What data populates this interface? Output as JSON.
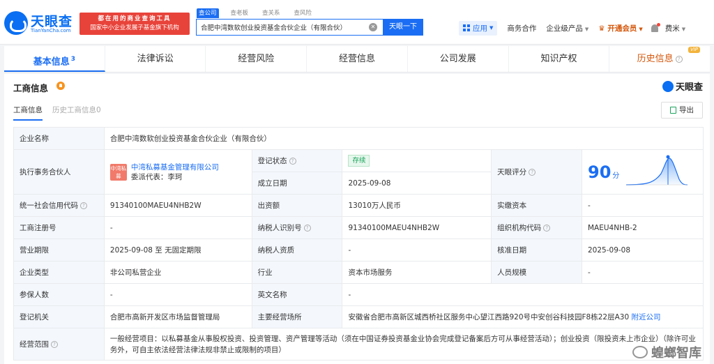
{
  "header": {
    "logo_text": "天眼查",
    "logo_sub": "TianYanCha.com",
    "banner_line1": "都在用的商业查询工具",
    "banner_line2": "国家中小企业发展子基金旗下机构",
    "search_tabs": [
      "查公司",
      "查老板",
      "查关系",
      "查风险"
    ],
    "search_value": "合肥中湾数软创业投资基金合伙企业（有限合伙）",
    "search_button": "天眼一下",
    "app_label": "应用",
    "nav_items": [
      "商务合作",
      "企业级产品"
    ],
    "vip_label": "开通会员",
    "user_label": "费米"
  },
  "tabs": [
    {
      "label": "基本信息",
      "count": "3"
    },
    {
      "label": "法律诉讼"
    },
    {
      "label": "经营风险"
    },
    {
      "label": "经营信息"
    },
    {
      "label": "公司发展"
    },
    {
      "label": "知识产权"
    },
    {
      "label": "历史信息",
      "badge": "VIP"
    }
  ],
  "card": {
    "title": "工商信息",
    "brand": "天眼查",
    "subtabs": [
      "工商信息",
      "历史工商信息0"
    ],
    "export_label": "导出"
  },
  "info": {
    "company_name_label": "企业名称",
    "company_name": "合肥中湾数软创业投资基金合伙企业（有限合伙）",
    "partner_label": "执行事务合伙人",
    "partner_logo": "中湾私募",
    "partner_name": "中湾私募基金管理有限公司",
    "partner_rep": "委派代表：李珂",
    "reg_status_label": "登记状态",
    "reg_status": "存续",
    "established_label": "成立日期",
    "established": "2025-09-08",
    "score_label": "天眼评分",
    "score": "90",
    "score_unit": "分",
    "credit_code_label": "统一社会信用代码",
    "credit_code": "91340100MAEU4NHB2W",
    "capital_label": "出资额",
    "capital": "13010万人民币",
    "paid_capital_label": "实缴资本",
    "paid_capital": "-",
    "reg_no_label": "工商注册号",
    "reg_no": "-",
    "taxpayer_id_label": "纳税人识别号",
    "taxpayer_id": "91340100MAEU4NHB2W",
    "org_code_label": "组织机构代码",
    "org_code": "MAEU4NHB-2",
    "term_label": "营业期限",
    "term": "2025-09-08 至 无固定期限",
    "taxpayer_qual_label": "纳税人资质",
    "taxpayer_qual": "-",
    "approval_label": "核准日期",
    "approval": "2025-09-08",
    "type_label": "企业类型",
    "type": "非公司私营企业",
    "industry_label": "行业",
    "industry": "资本市场服务",
    "staff_label": "人员规模",
    "staff": "-",
    "insured_label": "参保人数",
    "insured": "-",
    "en_name_label": "英文名称",
    "en_name": "-",
    "authority_label": "登记机关",
    "authority": "合肥市高新开发区市场监督管理局",
    "address_label": "主要经营场所",
    "address": "安徽省合肥市高新区城西桥社区服务中心望江西路920号中安创谷科技园F8栋22层A30",
    "nearby_label": "附近公司",
    "scope_label": "经营范围",
    "scope": "一般经营项目：以私募基金从事股权投资、投资管理、资产管理等活动（须在中国证券投资基金业协会完成登记备案后方可从事经营活动）；创业投资（限投资未上市企业）（除许可业务外，可自主依法经营法律法规非禁止或限制的项目）"
  },
  "watermark": "蝗螂智库",
  "colors": {
    "accent": "#1b6ef3",
    "banner": "#e8433a",
    "status": "#19a35a"
  }
}
